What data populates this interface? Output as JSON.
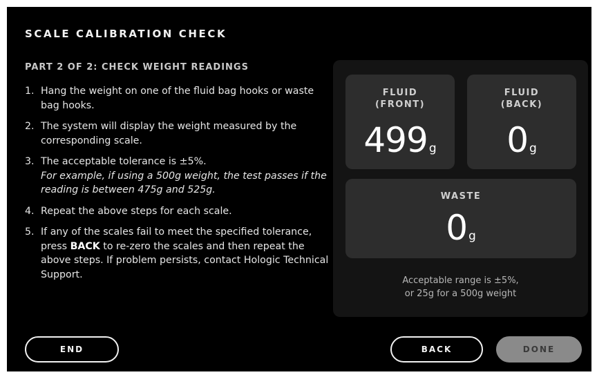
{
  "header": {
    "title": "SCALE CALIBRATION CHECK",
    "subtitle": "PART 2 OF 2: CHECK WEIGHT READINGS"
  },
  "steps": [
    {
      "num": "1.",
      "text": "Hang the weight on one of the fluid bag hooks or waste bag hooks."
    },
    {
      "num": "2.",
      "text": "The system will display the weight measured by the corresponding scale."
    },
    {
      "num": "3.",
      "text": "The acceptable tolerance is ±5%.",
      "example": "For example, if using a 500g weight, the test passes if the reading is between 475g and 525g."
    },
    {
      "num": "4.",
      "text": "Repeat the above steps for each scale."
    },
    {
      "num": "5.",
      "text_before": "If any of the scales fail to meet the specified tolerance, press ",
      "bold": "BACK",
      "text_after": " to re-zero the scales and then repeat the above steps. If problem persists, contact Hologic Technical Support."
    }
  ],
  "readings": {
    "fluid_front": {
      "label": "FLUID\n(FRONT)",
      "value": "499",
      "unit": "g"
    },
    "fluid_back": {
      "label": "FLUID\n(BACK)",
      "value": "0",
      "unit": "g"
    },
    "waste": {
      "label": "WASTE",
      "value": "0",
      "unit": "g"
    },
    "range_note": "Acceptable range is ±5%,\nor 25g for a 500g weight"
  },
  "buttons": {
    "end": "END",
    "back": "BACK",
    "done": "DONE"
  },
  "colors": {
    "background": "#000000",
    "tile": "#2d2d2d",
    "panel": "#141414",
    "done_disabled": "#8a8a8a"
  }
}
